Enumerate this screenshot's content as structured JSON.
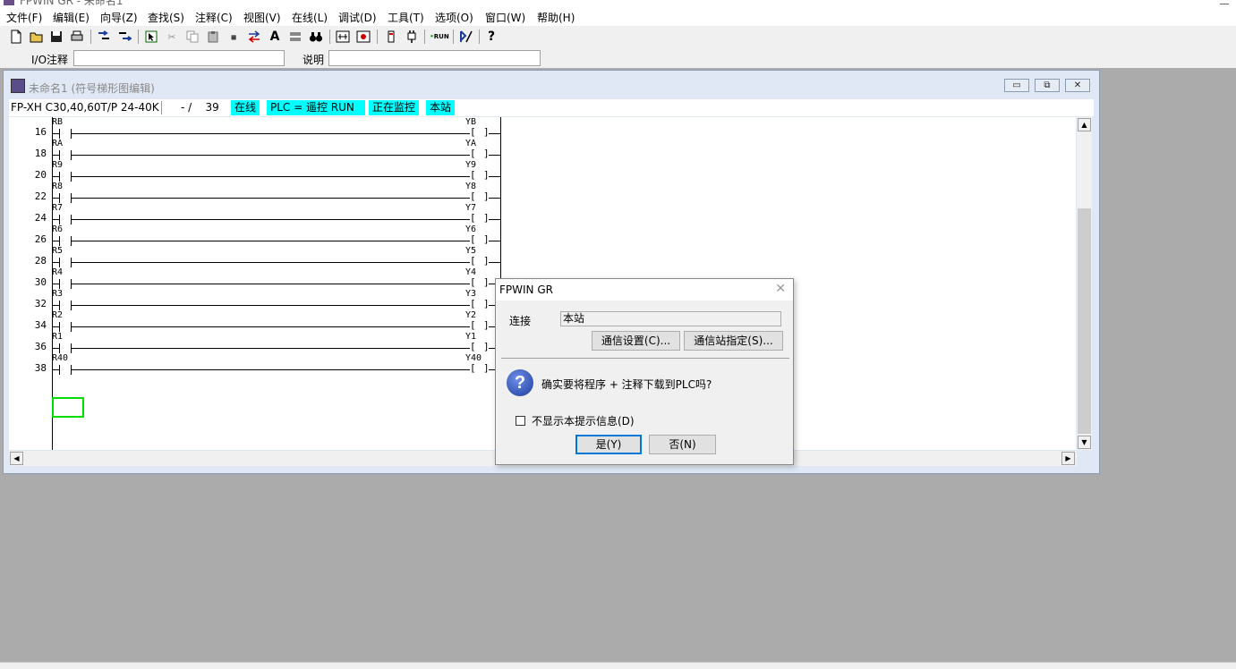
{
  "app": {
    "title_fragment": "FPWIN GR - 未命名1"
  },
  "menu": [
    "文件(F)",
    "编辑(E)",
    "向导(Z)",
    "查找(S)",
    "注释(C)",
    "视图(V)",
    "在线(L)",
    "调试(D)",
    "工具(T)",
    "选项(O)",
    "窗口(W)",
    "帮助(H)"
  ],
  "commentbar": {
    "io_label": "I/O注释",
    "desc_label": "说明",
    "io_value": "",
    "desc_value": ""
  },
  "child": {
    "title": "未命名1 (符号梯形图编辑)",
    "status": {
      "model": "FP-XH C30,40,60T/P 24-40K",
      "steps": "- /    39",
      "online": "在线",
      "plc_mode": "PLC =  遥控 RUN",
      "monitoring": "正在监控",
      "station": "本站"
    },
    "rungs": [
      {
        "num": "16",
        "contact": "RB",
        "coil": "YB"
      },
      {
        "num": "18",
        "contact": "RA",
        "coil": "YA"
      },
      {
        "num": "20",
        "contact": "R9",
        "coil": "Y9"
      },
      {
        "num": "22",
        "contact": "R8",
        "coil": "Y8"
      },
      {
        "num": "24",
        "contact": "R7",
        "coil": "Y7"
      },
      {
        "num": "26",
        "contact": "R6",
        "coil": "Y6"
      },
      {
        "num": "28",
        "contact": "R5",
        "coil": "Y5"
      },
      {
        "num": "30",
        "contact": "R4",
        "coil": "Y4"
      },
      {
        "num": "32",
        "contact": "R3",
        "coil": "Y3"
      },
      {
        "num": "34",
        "contact": "R2",
        "coil": "Y2"
      },
      {
        "num": "36",
        "contact": "R1",
        "coil": "Y1"
      },
      {
        "num": "38",
        "contact": "R40",
        "coil": "Y40"
      }
    ]
  },
  "dialog": {
    "title": "FPWIN GR",
    "connect_label": "连接",
    "connect_value": "本站",
    "comm_settings_button": "通信设置(C)...",
    "station_button": "通信站指定(S)...",
    "message": "确实要将程序 + 注释下载到PLC吗?",
    "dont_show_label": "不显示本提示信息(D)",
    "yes_button": "是(Y)",
    "no_button": "否(N)"
  }
}
